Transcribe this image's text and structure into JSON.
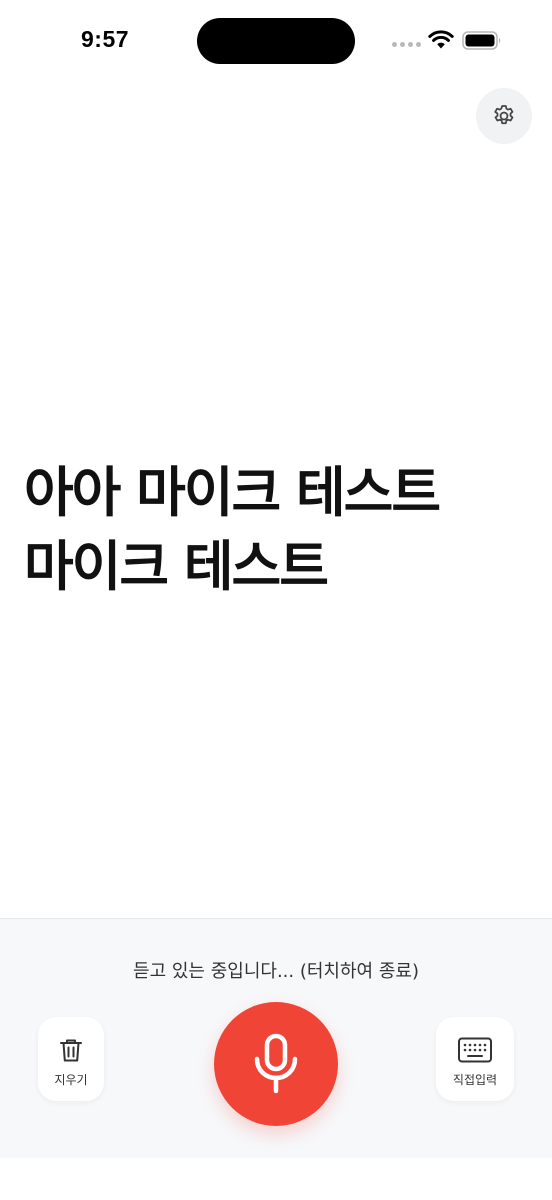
{
  "status_bar": {
    "time": "9:57",
    "icons": [
      "cellular-dots-icon",
      "wifi-icon",
      "battery-icon"
    ]
  },
  "header": {
    "settings_icon": "gear-icon"
  },
  "transcript": {
    "lines": [
      "아아 마이크 테스트",
      "마이크 테스트"
    ]
  },
  "bottom_panel": {
    "status_text": "듣고 있는 중입니다... (터치하여 종료)",
    "clear_button": {
      "label": "지우기",
      "icon": "trash-icon"
    },
    "mic_button": {
      "icon": "microphone-icon",
      "color": "#f04436"
    },
    "keyboard_button": {
      "label": "직접입력",
      "icon": "keyboard-icon"
    }
  },
  "colors": {
    "accent": "#f04436",
    "panel_background": "#f7f8fa",
    "settings_background": "#f1f2f4"
  }
}
